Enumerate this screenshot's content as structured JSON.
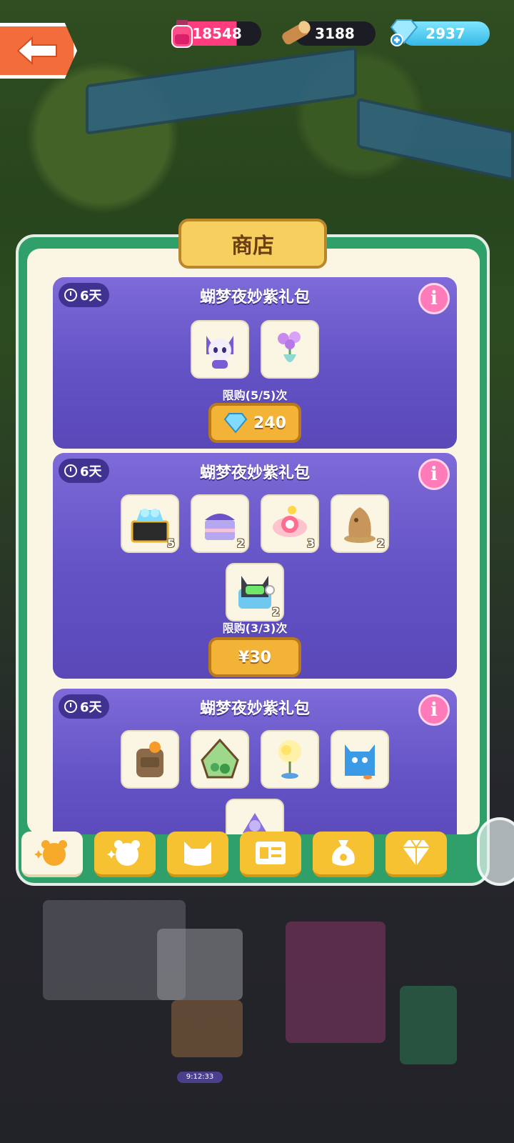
{
  "resources": [
    {
      "name": "potion",
      "value": "18548",
      "icon": "pink-potion-icon"
    },
    {
      "name": "wood",
      "value": "3188",
      "icon": "wood-log-icon"
    },
    {
      "name": "diamond",
      "value": "2937",
      "icon": "blue-diamond-plus-icon"
    }
  ],
  "shop": {
    "title": "商店",
    "packs": [
      {
        "timer": "6天",
        "title": "蝴梦夜妙紫礼包",
        "items": [
          {
            "icon": "purple-cat-doll-icon",
            "qty": ""
          },
          {
            "icon": "purple-flower-vase-icon",
            "qty": ""
          }
        ],
        "limit": "限购(5/5)次",
        "price": "240",
        "currency": "diamond"
      },
      {
        "timer": "6天",
        "title": "蝴梦夜妙紫礼包",
        "items": [
          {
            "icon": "diamond-chest-icon",
            "qty": "5"
          },
          {
            "icon": "purple-cake-icon",
            "qty": "2"
          },
          {
            "icon": "candy-orb-icon",
            "qty": "3"
          },
          {
            "icon": "wooden-statue-icon",
            "qty": "2"
          },
          {
            "icon": "robot-cat-headphones-icon",
            "qty": "2"
          }
        ],
        "limit": "限购(3/3)次",
        "price": "¥30",
        "currency": "cash"
      },
      {
        "timer": "6天",
        "title": "蝴梦夜妙紫礼包",
        "items": [
          {
            "icon": "orange-backpack-icon",
            "qty": ""
          },
          {
            "icon": "green-terrarium-icon",
            "qty": ""
          },
          {
            "icon": "glowing-tree-lamp-icon",
            "qty": ""
          },
          {
            "icon": "blue-cat-box-icon",
            "qty": ""
          },
          {
            "icon": "purple-crystal-icon",
            "qty": ""
          }
        ]
      }
    ]
  },
  "tabs": [
    {
      "name": "featured-bear",
      "icon": "bear-sparkle-icon",
      "active": true
    },
    {
      "name": "bear",
      "icon": "bear-sparkle-icon",
      "active": false
    },
    {
      "name": "cat",
      "icon": "cat-face-icon",
      "active": false
    },
    {
      "name": "card",
      "icon": "id-card-icon",
      "active": false
    },
    {
      "name": "bag",
      "icon": "money-bag-icon",
      "active": false
    },
    {
      "name": "diamond",
      "icon": "diamond-icon",
      "active": false
    }
  ],
  "status_time": "9:12:33",
  "colors": {
    "accent_green": "#2fa06a",
    "card_purple": "#6252c4",
    "button_gold": "#f2b336",
    "info_pink": "#ff7ab9"
  }
}
